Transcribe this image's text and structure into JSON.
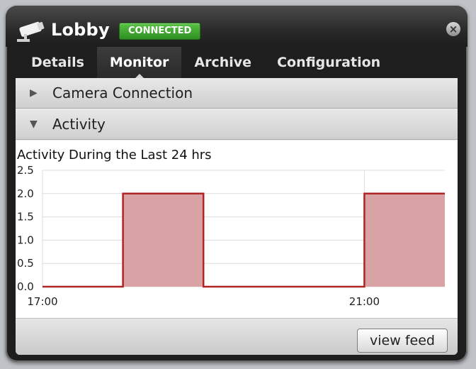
{
  "window": {
    "title": "Lobby",
    "status_badge": "CONNECTED",
    "close_glyph": "×"
  },
  "tabs": [
    {
      "label": "Details"
    },
    {
      "label": "Monitor",
      "active": true
    },
    {
      "label": "Archive"
    },
    {
      "label": "Configuration"
    }
  ],
  "sections": {
    "camera_connection": {
      "label": "Camera Connection",
      "arrow": "▶",
      "expanded": false
    },
    "activity": {
      "label": "Activity",
      "arrow": "▼",
      "expanded": true
    }
  },
  "footer": {
    "view_feed_label": "view feed"
  },
  "colors": {
    "accent_green": "#3fa72f",
    "bar_fill": "#d9a3a6",
    "bar_line": "#b02424"
  },
  "chart_data": {
    "type": "area",
    "title": "Activity During the Last 24 hrs",
    "x_tick_labels": [
      "17:00",
      "21:00"
    ],
    "y_tick_labels": [
      "0.0",
      "0.5",
      "1.0",
      "1.5",
      "2.0",
      "2.5"
    ],
    "ylim": [
      0,
      2.5
    ],
    "x_domain": [
      0,
      5
    ],
    "x_ticks": [
      {
        "x": 0,
        "label": "17:00"
      },
      {
        "x": 4,
        "label": "21:00"
      }
    ],
    "segments": [
      {
        "start": 0,
        "end": 1,
        "value": 0
      },
      {
        "start": 1,
        "end": 2,
        "value": 2
      },
      {
        "start": 2,
        "end": 4,
        "value": 0
      },
      {
        "start": 4,
        "end": 5,
        "value": 2
      }
    ],
    "grid": true
  }
}
